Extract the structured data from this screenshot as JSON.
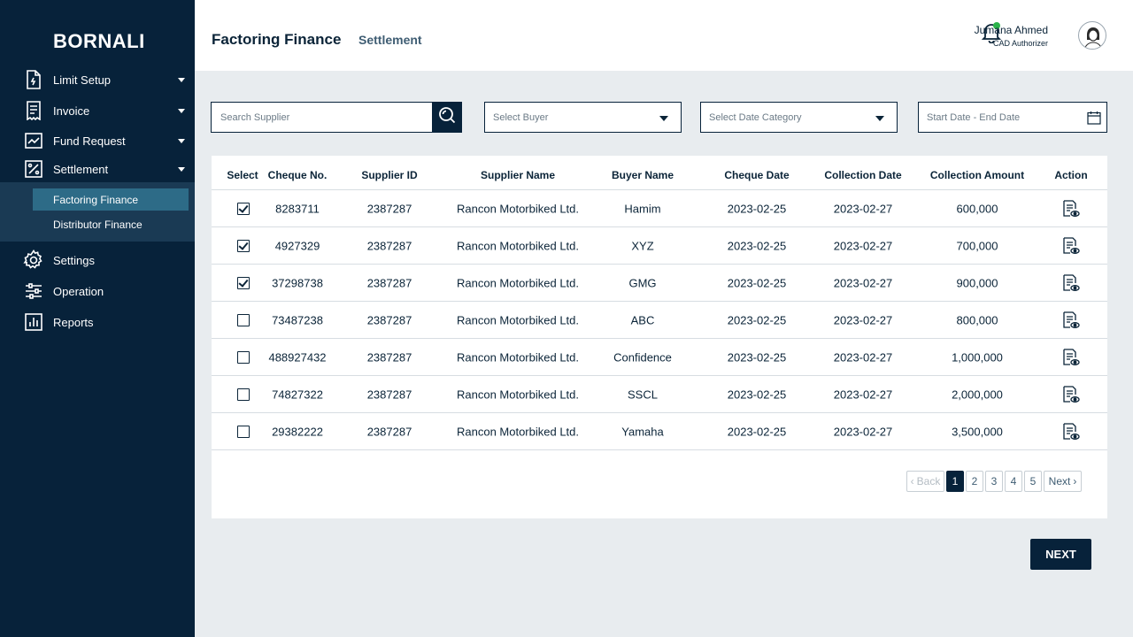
{
  "brand": "BORNALI",
  "sidebar": {
    "items": [
      {
        "label": "Limit Setup",
        "icon": "document-icon"
      },
      {
        "label": "Invoice",
        "icon": "invoice-icon"
      },
      {
        "label": "Fund Request",
        "icon": "chart-line-icon"
      },
      {
        "label": "Settlement",
        "icon": "percent-icon"
      },
      {
        "label": "Settings",
        "icon": "gear-icon"
      },
      {
        "label": "Operation",
        "icon": "sliders-icon"
      },
      {
        "label": "Reports",
        "icon": "bar-chart-icon"
      }
    ],
    "submenu": [
      {
        "label": "Factoring Finance",
        "active": true
      },
      {
        "label": "Distributor Finance",
        "active": false
      }
    ]
  },
  "header": {
    "title": "Factoring Finance",
    "breadcrumb": "Settlement",
    "user_name": "Jumana Ahmed",
    "user_role": "CAD Authorizer",
    "notification_color": "#2bb34a"
  },
  "filters": {
    "search_placeholder": "Search Supplier",
    "buyer_label": "Select Buyer",
    "date_category_label": "Select Date Category",
    "date_range_label": "Start Date - End Date"
  },
  "table": {
    "columns": [
      "Select",
      "Cheque No.",
      "Supplier ID",
      "Supplier Name",
      "Buyer Name",
      "Cheque Date",
      "Collection Date",
      "Collection Amount",
      "Action"
    ],
    "rows": [
      {
        "checked": true,
        "cheque": "8283711",
        "supplier_id": "2387287",
        "supplier": "Rancon Motorbiked Ltd.",
        "buyer": "Hamim",
        "cheque_date": "2023-02-25",
        "collection_date": "2023-02-27",
        "amount": "600,000"
      },
      {
        "checked": true,
        "cheque": "4927329",
        "supplier_id": "2387287",
        "supplier": "Rancon Motorbiked Ltd.",
        "buyer": "XYZ",
        "cheque_date": "2023-02-25",
        "collection_date": "2023-02-27",
        "amount": "700,000"
      },
      {
        "checked": true,
        "cheque": "37298738",
        "supplier_id": "2387287",
        "supplier": "Rancon Motorbiked Ltd.",
        "buyer": "GMG",
        "cheque_date": "2023-02-25",
        "collection_date": "2023-02-27",
        "amount": "900,000"
      },
      {
        "checked": false,
        "cheque": "73487238",
        "supplier_id": "2387287",
        "supplier": "Rancon Motorbiked Ltd.",
        "buyer": "ABC",
        "cheque_date": "2023-02-25",
        "collection_date": "2023-02-27",
        "amount": "800,000"
      },
      {
        "checked": false,
        "cheque": "488927432",
        "supplier_id": "2387287",
        "supplier": "Rancon Motorbiked Ltd.",
        "buyer": "Confidence",
        "cheque_date": "2023-02-25",
        "collection_date": "2023-02-27",
        "amount": "1,000,000"
      },
      {
        "checked": false,
        "cheque": "74827322",
        "supplier_id": "2387287",
        "supplier": "Rancon Motorbiked Ltd.",
        "buyer": "SSCL",
        "cheque_date": "2023-02-25",
        "collection_date": "2023-02-27",
        "amount": "2,000,000"
      },
      {
        "checked": false,
        "cheque": "29382222",
        "supplier_id": "2387287",
        "supplier": "Rancon Motorbiked Ltd.",
        "buyer": "Yamaha",
        "cheque_date": "2023-02-25",
        "collection_date": "2023-02-27",
        "amount": "3,500,000"
      }
    ]
  },
  "pagination": {
    "back_label": "Back",
    "pages": [
      "1",
      "2",
      "3",
      "4",
      "5"
    ],
    "current_page": "1",
    "next_label": "Next"
  },
  "next_button": "NEXT",
  "colors": {
    "sidebar_bg": "#07223a",
    "accent": "#2d6b87",
    "page_bg": "#e8ecef"
  }
}
